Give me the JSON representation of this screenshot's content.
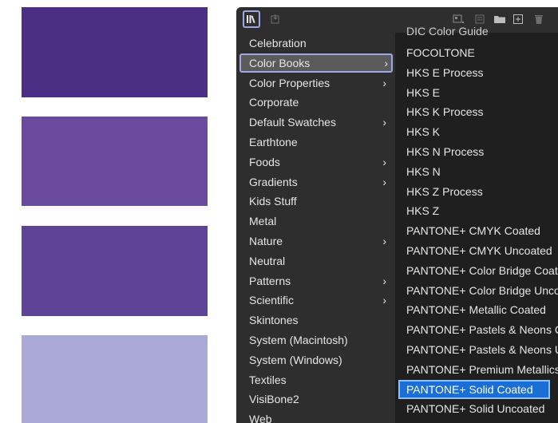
{
  "swatches": [
    {
      "name": "deep-violet",
      "color": "#4b2f84"
    },
    {
      "name": "medium-violet",
      "color": "#6a4a9d"
    },
    {
      "name": "royal-violet",
      "color": "#5d4497"
    },
    {
      "name": "lavender",
      "color": "#a9abd6"
    }
  ],
  "toolbar": {
    "library_icon": "swatch-libraries-menu-icon",
    "icons": [
      "import-icon",
      "show-kinds-icon",
      "swatch-options-icon",
      "folder-icon",
      "new-swatch-icon",
      "delete-icon"
    ]
  },
  "left_menu": {
    "items": [
      {
        "label": "Celebration",
        "submenu": false
      },
      {
        "label": "Color Books",
        "submenu": true,
        "selected": true
      },
      {
        "label": "Color Properties",
        "submenu": true
      },
      {
        "label": "Corporate",
        "submenu": false
      },
      {
        "label": "Default Swatches",
        "submenu": true
      },
      {
        "label": "Earthtone",
        "submenu": false
      },
      {
        "label": "Foods",
        "submenu": true
      },
      {
        "label": "Gradients",
        "submenu": true
      },
      {
        "label": "Kids Stuff",
        "submenu": false
      },
      {
        "label": "Metal",
        "submenu": false
      },
      {
        "label": "Nature",
        "submenu": true
      },
      {
        "label": "Neutral",
        "submenu": false
      },
      {
        "label": "Patterns",
        "submenu": true
      },
      {
        "label": "Scientific",
        "submenu": true
      },
      {
        "label": "Skintones",
        "submenu": false
      },
      {
        "label": "System (Macintosh)",
        "submenu": false
      },
      {
        "label": "System (Windows)",
        "submenu": false
      },
      {
        "label": "Textiles",
        "submenu": false
      },
      {
        "label": "VisiBone2",
        "submenu": false
      },
      {
        "label": "Web",
        "submenu": false
      }
    ],
    "chevron": "›"
  },
  "submenu": {
    "clipped_top": "DIC Color Guide",
    "items": [
      "FOCOLTONE",
      "HKS E Process",
      "HKS E",
      "HKS K Process",
      "HKS K",
      "HKS N Process",
      "HKS N",
      "HKS Z Process",
      "HKS Z",
      "PANTONE+ CMYK Coated",
      "PANTONE+ CMYK Uncoated",
      "PANTONE+ Color Bridge Coated",
      "PANTONE+ Color Bridge Uncoated",
      "PANTONE+ Metallic Coated",
      "PANTONE+ Pastels & Neons Coated",
      "PANTONE+ Pastels & Neons Uncoated",
      "PANTONE+ Premium Metallics Coated",
      "PANTONE+ Solid Coated",
      "PANTONE+ Solid Uncoated"
    ],
    "highlighted_index": 17
  }
}
